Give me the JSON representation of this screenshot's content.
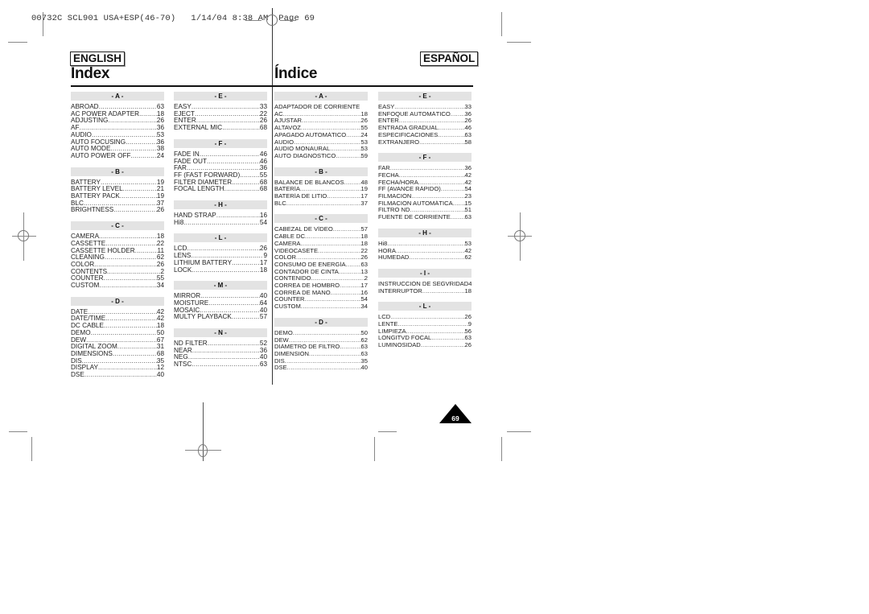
{
  "slug": "00732C SCL901 USA+ESP(46-70)   1/14/04 8:38 AM  Page 69",
  "english": {
    "badge": "ENGLISH",
    "title": "Index",
    "columns": [
      [
        {
          "letter": "- A -",
          "entries": [
            {
              "label": "ABROAD",
              "page": "63"
            },
            {
              "label": "AC POWER ADAPTER",
              "page": "18"
            },
            {
              "label": "ADJUSTING",
              "page": "26"
            },
            {
              "label": "AF",
              "page": "36"
            },
            {
              "label": "AUDIO",
              "page": "53"
            },
            {
              "label": "AUTO FOCUSING",
              "page": "36"
            },
            {
              "label": "AUTO MODE",
              "page": "38"
            },
            {
              "label": "AUTO POWER OFF",
              "page": "24"
            }
          ]
        },
        {
          "letter": "- B -",
          "entries": [
            {
              "label": "BATTERY",
              "page": "19"
            },
            {
              "label": "BATTERY LEVEL",
              "page": "21"
            },
            {
              "label": "BATTERY PACK",
              "page": "19"
            },
            {
              "label": "BLC",
              "page": "37"
            },
            {
              "label": "BRIGHTNESS",
              "page": "26"
            }
          ]
        },
        {
          "letter": "- C -",
          "entries": [
            {
              "label": "CAMERA",
              "page": "18"
            },
            {
              "label": "CASSETTE",
              "page": "22"
            },
            {
              "label": "CASSETTE HOLDER",
              "page": "11"
            },
            {
              "label": "CLEANING",
              "page": "62"
            },
            {
              "label": "COLOR",
              "page": "26"
            },
            {
              "label": "CONTENTS",
              "page": "2"
            },
            {
              "label": "COUNTER",
              "page": "55"
            },
            {
              "label": "CUSTOM",
              "page": "34"
            }
          ]
        },
        {
          "letter": "- D -",
          "entries": [
            {
              "label": "DATE",
              "page": "42"
            },
            {
              "label": "DATE/TIME",
              "page": "42"
            },
            {
              "label": "DC CABLE",
              "page": "18"
            },
            {
              "label": "DEMO",
              "page": "50"
            },
            {
              "label": "DEW",
              "page": "67"
            },
            {
              "label": "DIGITAL ZOOM",
              "page": "31"
            },
            {
              "label": "DIMENSIONS",
              "page": "68"
            },
            {
              "label": "DIS",
              "page": "35"
            },
            {
              "label": "DISPLAY",
              "page": "12"
            },
            {
              "label": "DSE",
              "page": "40"
            }
          ]
        }
      ],
      [
        {
          "letter": "- E -",
          "entries": [
            {
              "label": "EASY",
              "page": "33"
            },
            {
              "label": "EJECT",
              "page": "22"
            },
            {
              "label": "ENTER",
              "page": "26"
            },
            {
              "label": "EXTERNAL MIC",
              "page": "68"
            }
          ]
        },
        {
          "letter": "- F -",
          "entries": [
            {
              "label": "FADE IN",
              "page": "46"
            },
            {
              "label": "FADE OUT",
              "page": "46"
            },
            {
              "label": "FAR",
              "page": "36"
            },
            {
              "label": "FF (FAST FORWARD)",
              "page": "55"
            },
            {
              "label": "FILTER DIAMETER",
              "page": "68"
            },
            {
              "label": "FOCAL LENGTH",
              "page": "68"
            }
          ]
        },
        {
          "letter": "- H -",
          "entries": [
            {
              "label": "HAND STRAP",
              "page": "16"
            },
            {
              "label": "Hi8",
              "page": "54"
            }
          ]
        },
        {
          "letter": "- L -",
          "entries": [
            {
              "label": "LCD",
              "page": "26"
            },
            {
              "label": "LENS",
              "page": "9"
            },
            {
              "label": "LITHIUM BATTERY",
              "page": "17"
            },
            {
              "label": "LOCK",
              "page": "18"
            }
          ]
        },
        {
          "letter": "- M -",
          "entries": [
            {
              "label": "MIRROR",
              "page": "40"
            },
            {
              "label": "MOISTURE",
              "page": "64"
            },
            {
              "label": "MOSAIC",
              "page": "40"
            },
            {
              "label": "MULTY PLAYBACK",
              "page": "57"
            }
          ]
        },
        {
          "letter": "- N -",
          "entries": [
            {
              "label": "ND FILTER",
              "page": "52"
            },
            {
              "label": "NEAR",
              "page": "36"
            },
            {
              "label": "NEG",
              "page": "40"
            },
            {
              "label": "NTSC",
              "page": "63"
            }
          ]
        }
      ]
    ]
  },
  "spanish": {
    "badge": "ESPAÑOL",
    "title": "Índice",
    "columns": [
      [
        {
          "letter": "- A -",
          "entries": [
            {
              "label": "ADAPTADOR DE CORRIENTE",
              "page": ""
            },
            {
              "label": "AC",
              "page": "18"
            },
            {
              "label": "AJUSTAR",
              "page": "26"
            },
            {
              "label": "ALTAVOZ",
              "page": "55"
            },
            {
              "label": "APAGADO AUTOMÁTICO",
              "page": "24"
            },
            {
              "label": "AUDIO",
              "page": "53"
            },
            {
              "label": "AUDIO MONAURAL",
              "page": "53"
            },
            {
              "label": "AUTO DIAGNÓSTICO",
              "page": "59"
            }
          ]
        },
        {
          "letter": "- B -",
          "entries": [
            {
              "label": "BALANCE DE BLANCOS",
              "page": "48"
            },
            {
              "label": "BATERÍA",
              "page": "19"
            },
            {
              "label": "BATERÍA DE LITIO",
              "page": "17"
            },
            {
              "label": "BLC",
              "page": "37"
            }
          ]
        },
        {
          "letter": "- C -",
          "entries": [
            {
              "label": "CABEZAL DE VÍDEO",
              "page": "57"
            },
            {
              "label": "CABLE DC",
              "page": "18"
            },
            {
              "label": "CAMERA",
              "page": "18"
            },
            {
              "label": "VIDEOCASETE",
              "page": "22"
            },
            {
              "label": "COLOR",
              "page": "26"
            },
            {
              "label": "CONSUMO DE ENERGÍA",
              "page": "63"
            },
            {
              "label": "CONTADOR DE CINTA",
              "page": "13"
            },
            {
              "label": "CONTENIDO",
              "page": "2"
            },
            {
              "label": "CORREA DE HOMBRO",
              "page": "17"
            },
            {
              "label": "CORREA DE MANO",
              "page": "16"
            },
            {
              "label": "COUNTER",
              "page": "54"
            },
            {
              "label": "CUSTOM",
              "page": "34"
            }
          ]
        },
        {
          "letter": "- D -",
          "entries": [
            {
              "label": "DEMO",
              "page": "50"
            },
            {
              "label": "DEW",
              "page": "62"
            },
            {
              "label": "DIÁMETRO DE FILTRO",
              "page": "63"
            },
            {
              "label": "DIMENSIÓN",
              "page": "63"
            },
            {
              "label": "DIS",
              "page": "35"
            },
            {
              "label": "DSE",
              "page": "40"
            }
          ]
        }
      ],
      [
        {
          "letter": "- E -",
          "entries": [
            {
              "label": "EASY",
              "page": "33"
            },
            {
              "label": "ENFOQUE AUTOMÁTICO",
              "page": "36"
            },
            {
              "label": "ENTER",
              "page": "26"
            },
            {
              "label": "ENTRADA GRADUAL",
              "page": "46"
            },
            {
              "label": "ESPECIFICACIONES",
              "page": "63"
            },
            {
              "label": "EXTRANJERO",
              "page": "58"
            }
          ]
        },
        {
          "letter": "- F -",
          "entries": [
            {
              "label": "FAR",
              "page": "36"
            },
            {
              "label": "FECHA",
              "page": "42"
            },
            {
              "label": "FECHA/HORA",
              "page": "42"
            },
            {
              "label": "FF (AVANCE RÁPIDO)",
              "page": "54"
            },
            {
              "label": "FILMACIÓN",
              "page": "23"
            },
            {
              "label": "FILMACIÓN AUTOMÁTICA",
              "page": "15"
            },
            {
              "label": "FILTRO ND",
              "page": "51"
            },
            {
              "label": "FUENTE DE CORRIENTE",
              "page": "63"
            }
          ]
        },
        {
          "letter": "- H -",
          "entries": [
            {
              "label": "Hi8",
              "page": "53"
            },
            {
              "label": "HORA",
              "page": "42"
            },
            {
              "label": "HUMEDAD",
              "page": "62"
            }
          ]
        },
        {
          "letter": "- I -",
          "entries": [
            {
              "label": "INSTRUCCIÓN DE SEGVRIDAD",
              "page": "4"
            },
            {
              "label": "INTERRUPTOR",
              "page": "18"
            }
          ]
        },
        {
          "letter": "- L -",
          "entries": [
            {
              "label": "LCD",
              "page": "26"
            },
            {
              "label": "LENTE",
              "page": "9"
            },
            {
              "label": "LIMPIEZA",
              "page": "56"
            },
            {
              "label": "LONGITVD FOCAL",
              "page": "63"
            },
            {
              "label": "LUMINOSIDAD",
              "page": "26"
            }
          ]
        }
      ]
    ]
  },
  "page_number": "69"
}
